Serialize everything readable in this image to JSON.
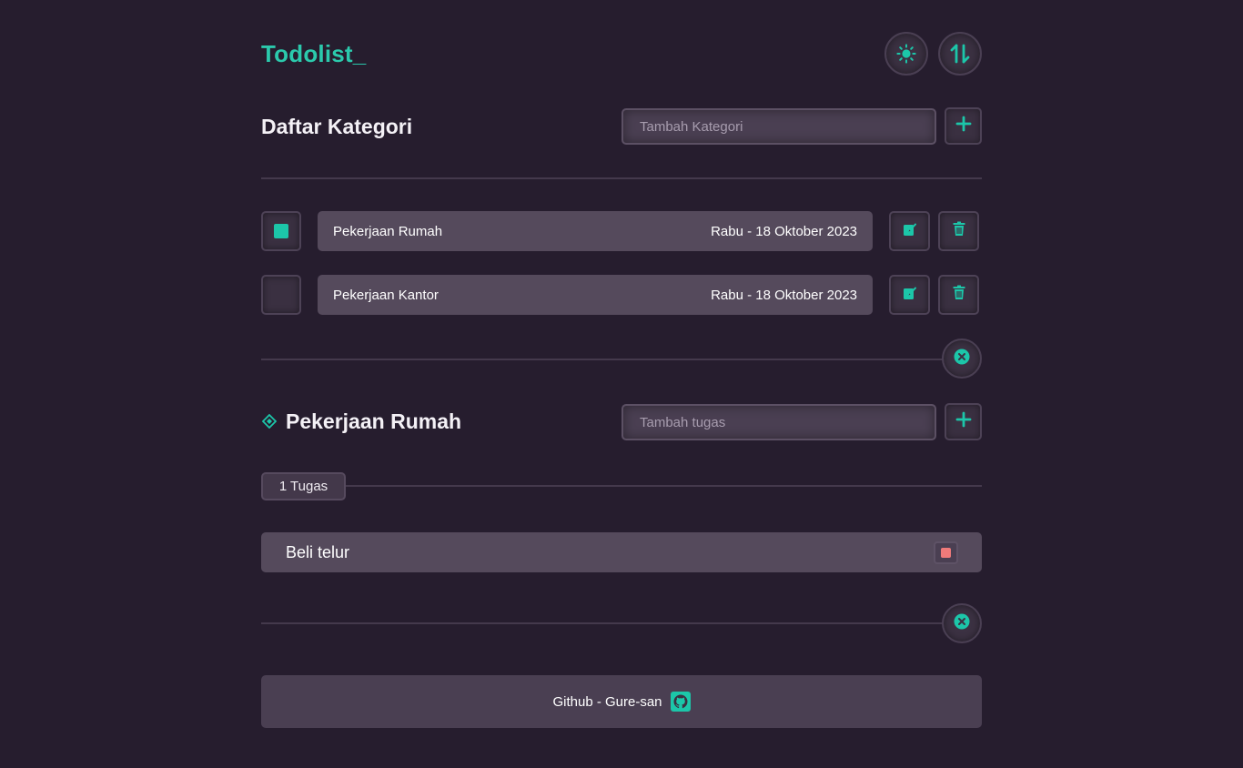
{
  "app": {
    "logo_text": "Todolist_"
  },
  "header": {
    "theme_icon": "sun-icon",
    "sort_icon": "sort-arrows-icon"
  },
  "categories": {
    "title": "Daftar Kategori",
    "input_placeholder": "Tambah Kategori",
    "items": [
      {
        "name": "Pekerjaan Rumah",
        "date": "Rabu - 18 Oktober 2023",
        "selected": true
      },
      {
        "name": "Pekerjaan Kantor",
        "date": "Rabu - 18 Oktober 2023",
        "selected": false
      }
    ]
  },
  "tasks": {
    "category_title": "Pekerjaan Rumah",
    "input_placeholder": "Tambah tugas",
    "count_label": "1 Tugas",
    "items": [
      {
        "text": "Beli telur",
        "status_color": "#ef7a7a"
      }
    ]
  },
  "footer": {
    "label": "Github - Gure-san",
    "icon": "github-icon"
  },
  "colors": {
    "accent": "#1cc6a9",
    "background": "#261d2e",
    "bar": "#554a5c",
    "danger": "#ef7a7a"
  }
}
